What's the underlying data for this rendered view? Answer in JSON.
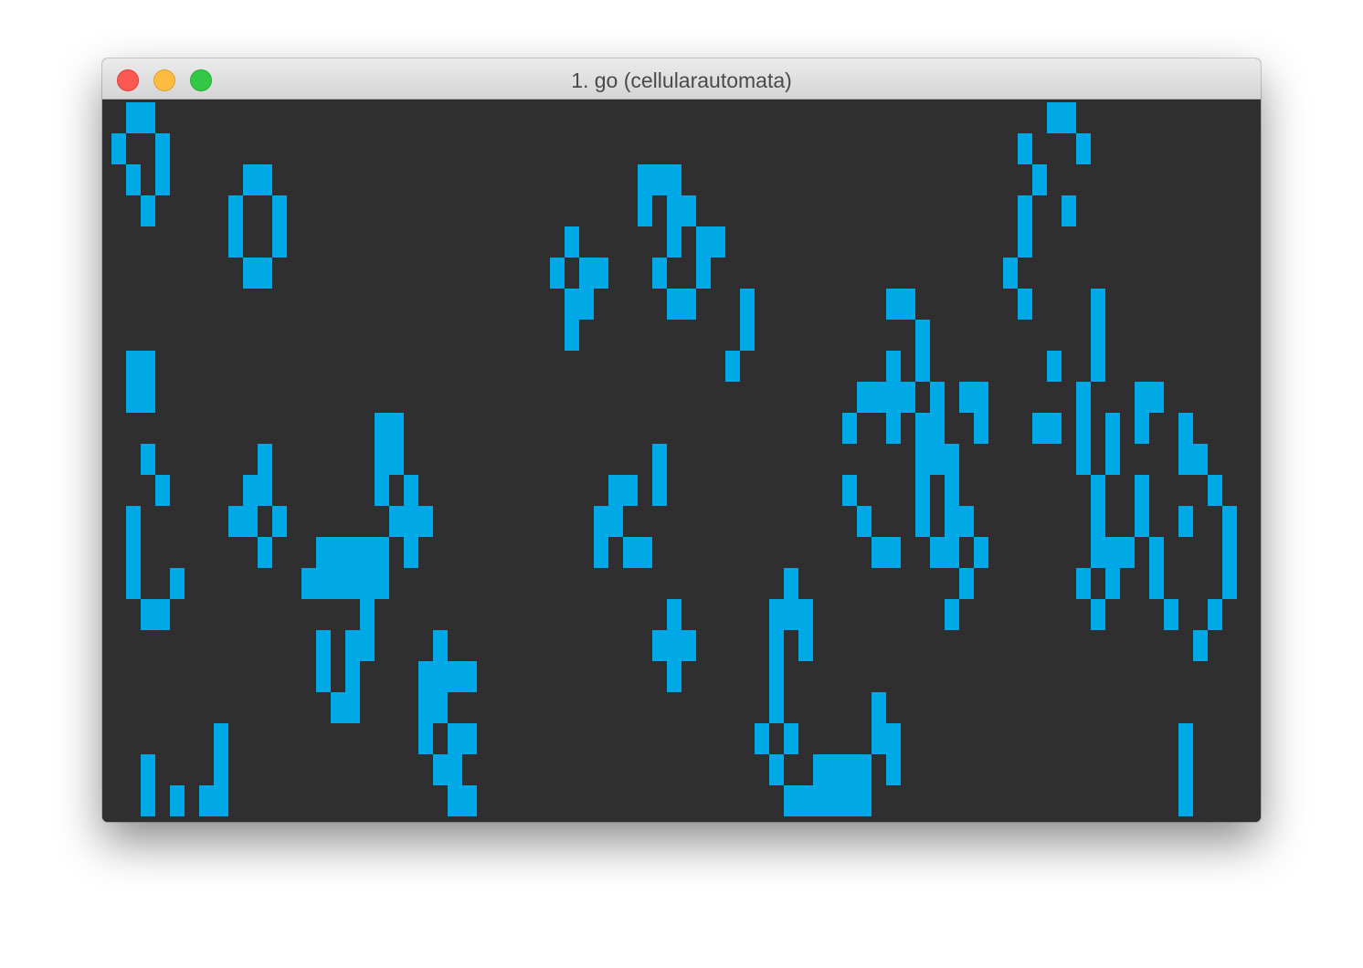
{
  "window": {
    "title": "1. go (cellularautomata)",
    "buttons": [
      "close",
      "minimize",
      "zoom"
    ]
  },
  "colors": {
    "background": "#2f2f2f",
    "cell": "#00a8e6"
  },
  "grid": {
    "alive_cells": [
      [
        0,
        1
      ],
      [
        0,
        2
      ],
      [
        0,
        64
      ],
      [
        0,
        65
      ],
      [
        1,
        0
      ],
      [
        1,
        3
      ],
      [
        1,
        62
      ],
      [
        1,
        66
      ],
      [
        2,
        1
      ],
      [
        2,
        3
      ],
      [
        2,
        9
      ],
      [
        2,
        10
      ],
      [
        2,
        36
      ],
      [
        2,
        37
      ],
      [
        2,
        38
      ],
      [
        2,
        63
      ],
      [
        3,
        2
      ],
      [
        3,
        8
      ],
      [
        3,
        11
      ],
      [
        3,
        36
      ],
      [
        3,
        38
      ],
      [
        3,
        39
      ],
      [
        3,
        62
      ],
      [
        3,
        65
      ],
      [
        4,
        8
      ],
      [
        4,
        11
      ],
      [
        4,
        31
      ],
      [
        4,
        38
      ],
      [
        4,
        40
      ],
      [
        4,
        41
      ],
      [
        4,
        62
      ],
      [
        5,
        9
      ],
      [
        5,
        10
      ],
      [
        5,
        30
      ],
      [
        5,
        32
      ],
      [
        5,
        33
      ],
      [
        5,
        37
      ],
      [
        5,
        40
      ],
      [
        5,
        61
      ],
      [
        6,
        31
      ],
      [
        6,
        32
      ],
      [
        6,
        38
      ],
      [
        6,
        39
      ],
      [
        6,
        43
      ],
      [
        6,
        53
      ],
      [
        6,
        54
      ],
      [
        6,
        62
      ],
      [
        6,
        67
      ],
      [
        7,
        31
      ],
      [
        7,
        43
      ],
      [
        7,
        55
      ],
      [
        7,
        67
      ],
      [
        8,
        1
      ],
      [
        8,
        2
      ],
      [
        8,
        42
      ],
      [
        8,
        53
      ],
      [
        8,
        55
      ],
      [
        8,
        64
      ],
      [
        8,
        67
      ],
      [
        9,
        1
      ],
      [
        9,
        2
      ],
      [
        9,
        51
      ],
      [
        9,
        52
      ],
      [
        9,
        53
      ],
      [
        9,
        54
      ],
      [
        9,
        56
      ],
      [
        9,
        58
      ],
      [
        9,
        59
      ],
      [
        9,
        66
      ],
      [
        9,
        70
      ],
      [
        9,
        71
      ],
      [
        10,
        18
      ],
      [
        10,
        19
      ],
      [
        10,
        50
      ],
      [
        10,
        53
      ],
      [
        10,
        55
      ],
      [
        10,
        56
      ],
      [
        10,
        59
      ],
      [
        10,
        63
      ],
      [
        10,
        64
      ],
      [
        10,
        66
      ],
      [
        10,
        68
      ],
      [
        10,
        70
      ],
      [
        10,
        73
      ],
      [
        11,
        2
      ],
      [
        11,
        10
      ],
      [
        11,
        18
      ],
      [
        11,
        19
      ],
      [
        11,
        37
      ],
      [
        11,
        55
      ],
      [
        11,
        56
      ],
      [
        11,
        57
      ],
      [
        11,
        66
      ],
      [
        11,
        68
      ],
      [
        11,
        73
      ],
      [
        11,
        74
      ],
      [
        12,
        3
      ],
      [
        12,
        9
      ],
      [
        12,
        10
      ],
      [
        12,
        18
      ],
      [
        12,
        20
      ],
      [
        12,
        34
      ],
      [
        12,
        35
      ],
      [
        12,
        37
      ],
      [
        12,
        50
      ],
      [
        12,
        55
      ],
      [
        12,
        57
      ],
      [
        12,
        67
      ],
      [
        12,
        70
      ],
      [
        12,
        75
      ],
      [
        13,
        1
      ],
      [
        13,
        8
      ],
      [
        13,
        9
      ],
      [
        13,
        11
      ],
      [
        13,
        19
      ],
      [
        13,
        20
      ],
      [
        13,
        21
      ],
      [
        13,
        33
      ],
      [
        13,
        34
      ],
      [
        13,
        51
      ],
      [
        13,
        55
      ],
      [
        13,
        57
      ],
      [
        13,
        58
      ],
      [
        13,
        67
      ],
      [
        13,
        70
      ],
      [
        13,
        73
      ],
      [
        13,
        76
      ],
      [
        14,
        1
      ],
      [
        14,
        10
      ],
      [
        14,
        14
      ],
      [
        14,
        15
      ],
      [
        14,
        16
      ],
      [
        14,
        17
      ],
      [
        14,
        18
      ],
      [
        14,
        20
      ],
      [
        14,
        33
      ],
      [
        14,
        35
      ],
      [
        14,
        36
      ],
      [
        14,
        52
      ],
      [
        14,
        53
      ],
      [
        14,
        56
      ],
      [
        14,
        57
      ],
      [
        14,
        59
      ],
      [
        14,
        67
      ],
      [
        14,
        68
      ],
      [
        14,
        69
      ],
      [
        14,
        71
      ],
      [
        14,
        76
      ],
      [
        15,
        1
      ],
      [
        15,
        4
      ],
      [
        15,
        13
      ],
      [
        15,
        14
      ],
      [
        15,
        15
      ],
      [
        15,
        16
      ],
      [
        15,
        17
      ],
      [
        15,
        18
      ],
      [
        15,
        46
      ],
      [
        15,
        58
      ],
      [
        15,
        66
      ],
      [
        15,
        68
      ],
      [
        15,
        71
      ],
      [
        15,
        76
      ],
      [
        16,
        2
      ],
      [
        16,
        3
      ],
      [
        16,
        17
      ],
      [
        16,
        38
      ],
      [
        16,
        45
      ],
      [
        16,
        46
      ],
      [
        16,
        47
      ],
      [
        16,
        57
      ],
      [
        16,
        67
      ],
      [
        16,
        72
      ],
      [
        16,
        75
      ],
      [
        17,
        14
      ],
      [
        17,
        16
      ],
      [
        17,
        17
      ],
      [
        17,
        22
      ],
      [
        17,
        37
      ],
      [
        17,
        38
      ],
      [
        17,
        39
      ],
      [
        17,
        45
      ],
      [
        17,
        47
      ],
      [
        17,
        74
      ],
      [
        18,
        14
      ],
      [
        18,
        16
      ],
      [
        18,
        21
      ],
      [
        18,
        22
      ],
      [
        18,
        23
      ],
      [
        18,
        24
      ],
      [
        18,
        38
      ],
      [
        18,
        45
      ],
      [
        19,
        15
      ],
      [
        19,
        16
      ],
      [
        19,
        21
      ],
      [
        19,
        22
      ],
      [
        19,
        45
      ],
      [
        19,
        52
      ],
      [
        20,
        7
      ],
      [
        20,
        21
      ],
      [
        20,
        23
      ],
      [
        20,
        24
      ],
      [
        20,
        44
      ],
      [
        20,
        46
      ],
      [
        20,
        52
      ],
      [
        20,
        53
      ],
      [
        20,
        73
      ],
      [
        21,
        2
      ],
      [
        21,
        7
      ],
      [
        21,
        22
      ],
      [
        21,
        23
      ],
      [
        21,
        45
      ],
      [
        21,
        48
      ],
      [
        21,
        49
      ],
      [
        21,
        50
      ],
      [
        21,
        51
      ],
      [
        21,
        53
      ],
      [
        21,
        73
      ],
      [
        22,
        2
      ],
      [
        22,
        4
      ],
      [
        22,
        6
      ],
      [
        22,
        7
      ],
      [
        22,
        23
      ],
      [
        22,
        24
      ],
      [
        22,
        46
      ],
      [
        22,
        47
      ],
      [
        22,
        48
      ],
      [
        22,
        49
      ],
      [
        22,
        50
      ],
      [
        22,
        51
      ],
      [
        22,
        73
      ]
    ]
  }
}
